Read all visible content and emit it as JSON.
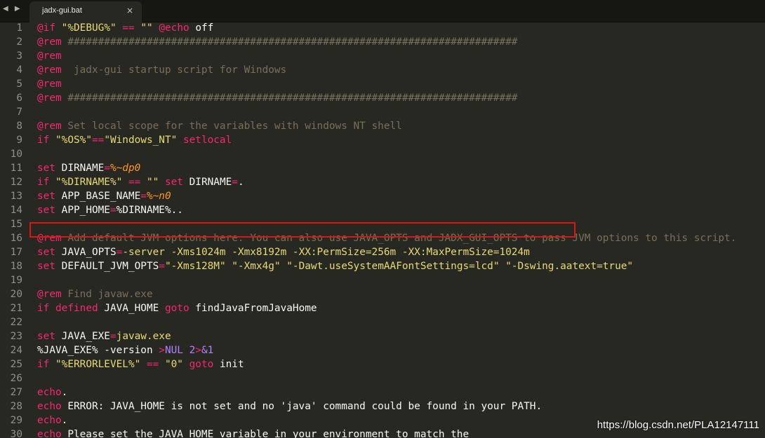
{
  "tab": {
    "title": "jadx-gui.bat",
    "close_glyph": "×"
  },
  "nav": {
    "arrows": "◀ ▶"
  },
  "lines": [
    {
      "num": "1",
      "tokens": [
        [
          "kw",
          "@if"
        ],
        [
          "code",
          " "
        ],
        [
          "str",
          "\"%DEBUG%\""
        ],
        [
          "code",
          " "
        ],
        [
          "kw",
          "=="
        ],
        [
          "code",
          " "
        ],
        [
          "str",
          "\"\""
        ],
        [
          "code",
          " "
        ],
        [
          "kw",
          "@echo"
        ],
        [
          "code",
          " off"
        ]
      ]
    },
    {
      "num": "2",
      "tokens": [
        [
          "kw",
          "@rem"
        ],
        [
          "cmt",
          " ##########################################################################"
        ]
      ]
    },
    {
      "num": "3",
      "tokens": [
        [
          "kw",
          "@rem"
        ]
      ]
    },
    {
      "num": "4",
      "tokens": [
        [
          "kw",
          "@rem"
        ],
        [
          "cmt",
          "  jadx-gui startup script for Windows"
        ]
      ]
    },
    {
      "num": "5",
      "tokens": [
        [
          "kw",
          "@rem"
        ]
      ]
    },
    {
      "num": "6",
      "tokens": [
        [
          "kw",
          "@rem"
        ],
        [
          "cmt",
          " ##########################################################################"
        ]
      ]
    },
    {
      "num": "7",
      "tokens": []
    },
    {
      "num": "8",
      "tokens": [
        [
          "kw",
          "@rem"
        ],
        [
          "cmt",
          " Set local scope for the variables with windows NT shell"
        ]
      ]
    },
    {
      "num": "9",
      "tokens": [
        [
          "kw",
          "if"
        ],
        [
          "code",
          " "
        ],
        [
          "str",
          "\"%OS%\""
        ],
        [
          "kw",
          "=="
        ],
        [
          "str",
          "\"Windows_NT\""
        ],
        [
          "code",
          " "
        ],
        [
          "kw",
          "setlocal"
        ]
      ]
    },
    {
      "num": "10",
      "tokens": []
    },
    {
      "num": "11",
      "tokens": [
        [
          "kw",
          "set"
        ],
        [
          "code",
          " DIRNAME"
        ],
        [
          "kw",
          "="
        ],
        [
          "var",
          "%~dp0"
        ]
      ]
    },
    {
      "num": "12",
      "tokens": [
        [
          "kw",
          "if"
        ],
        [
          "code",
          " "
        ],
        [
          "str",
          "\"%DIRNAME%\""
        ],
        [
          "code",
          " "
        ],
        [
          "kw",
          "=="
        ],
        [
          "code",
          " "
        ],
        [
          "str",
          "\"\""
        ],
        [
          "code",
          " "
        ],
        [
          "kw",
          "set"
        ],
        [
          "code",
          " DIRNAME"
        ],
        [
          "kw",
          "="
        ],
        [
          "code",
          "."
        ]
      ]
    },
    {
      "num": "13",
      "tokens": [
        [
          "kw",
          "set"
        ],
        [
          "code",
          " APP_BASE_NAME"
        ],
        [
          "kw",
          "="
        ],
        [
          "var",
          "%~n0"
        ]
      ]
    },
    {
      "num": "14",
      "tokens": [
        [
          "kw",
          "set"
        ],
        [
          "code",
          " APP_HOME"
        ],
        [
          "kw",
          "="
        ],
        [
          "code",
          "%DIRNAME%.."
        ]
      ]
    },
    {
      "num": "15",
      "tokens": []
    },
    {
      "num": "16",
      "tokens": [
        [
          "kw",
          "@rem"
        ],
        [
          "cmt",
          " Add default JVM options here. You can also use JAVA_OPTS and JADX_GUI_OPTS to pass JVM options to this script."
        ]
      ]
    },
    {
      "num": "17",
      "tokens": [
        [
          "kw",
          "set"
        ],
        [
          "code",
          " JAVA_OPTS"
        ],
        [
          "kw",
          "="
        ],
        [
          "str",
          "-server -Xms1024m -Xmx8192m -XX:PermSize=256m -XX:MaxPermSize=1024m"
        ]
      ]
    },
    {
      "num": "18",
      "tokens": [
        [
          "kw",
          "set"
        ],
        [
          "code",
          " DEFAULT_JVM_OPTS"
        ],
        [
          "kw",
          "="
        ],
        [
          "str",
          "\"-Xms128M\" \"-Xmx4g\" \"-Dawt.useSystemAAFontSettings=lcd\" \"-Dswing.aatext=true\""
        ]
      ]
    },
    {
      "num": "19",
      "tokens": []
    },
    {
      "num": "20",
      "tokens": [
        [
          "kw",
          "@rem"
        ],
        [
          "cmt",
          " Find javaw.exe"
        ]
      ]
    },
    {
      "num": "21",
      "tokens": [
        [
          "kw",
          "if"
        ],
        [
          "code",
          " "
        ],
        [
          "kw",
          "defined"
        ],
        [
          "code",
          " JAVA_HOME "
        ],
        [
          "kw",
          "goto"
        ],
        [
          "code",
          " findJavaFromJavaHome"
        ]
      ]
    },
    {
      "num": "22",
      "tokens": []
    },
    {
      "num": "23",
      "tokens": [
        [
          "kw",
          "set"
        ],
        [
          "code",
          " JAVA_EXE"
        ],
        [
          "kw",
          "="
        ],
        [
          "str",
          "javaw.exe"
        ]
      ]
    },
    {
      "num": "24",
      "tokens": [
        [
          "code",
          "%JAVA_EXE% -version "
        ],
        [
          "kw",
          ">"
        ],
        [
          "num",
          "NUL"
        ],
        [
          "code",
          " "
        ],
        [
          "num",
          "2"
        ],
        [
          "kw",
          ">"
        ],
        [
          "num",
          "&1"
        ]
      ]
    },
    {
      "num": "25",
      "tokens": [
        [
          "kw",
          "if"
        ],
        [
          "code",
          " "
        ],
        [
          "str",
          "\"%ERRORLEVEL%\""
        ],
        [
          "code",
          " "
        ],
        [
          "kw",
          "=="
        ],
        [
          "code",
          " "
        ],
        [
          "str",
          "\"0\""
        ],
        [
          "code",
          " "
        ],
        [
          "kw",
          "goto"
        ],
        [
          "code",
          " init"
        ]
      ]
    },
    {
      "num": "26",
      "tokens": []
    },
    {
      "num": "27",
      "tokens": [
        [
          "kw",
          "echo"
        ],
        [
          "code",
          "."
        ]
      ]
    },
    {
      "num": "28",
      "tokens": [
        [
          "kw",
          "echo"
        ],
        [
          "code",
          " ERROR: JAVA_HOME is not set and no 'java' command could be found in your PATH."
        ]
      ]
    },
    {
      "num": "29",
      "tokens": [
        [
          "kw",
          "echo"
        ],
        [
          "code",
          "."
        ]
      ]
    },
    {
      "num": "30",
      "tokens": [
        [
          "kw",
          "echo"
        ],
        [
          "code",
          " Please set the JAVA_HOME variable in your environment to match the"
        ]
      ]
    }
  ],
  "watermark": "https://blog.csdn.net/PLA12147111"
}
